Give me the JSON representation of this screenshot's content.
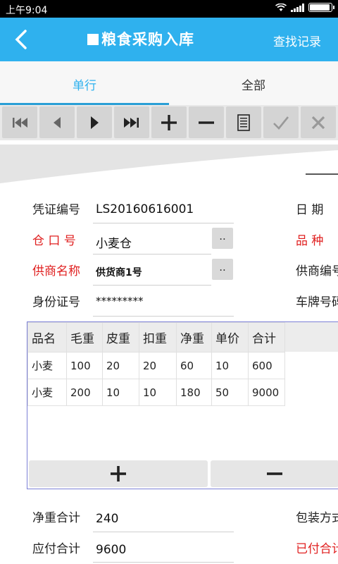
{
  "status": {
    "time": "上午9:04"
  },
  "appbar": {
    "title": "粮食采购入库",
    "find": "查找记录"
  },
  "tabs": [
    {
      "label": "单行"
    },
    {
      "label": "全部"
    }
  ],
  "toolbar": [
    "first-icon",
    "prev-icon",
    "next-icon",
    "last-icon",
    "add-icon",
    "remove-icon",
    "document-icon",
    "check-icon",
    "cancel-icon"
  ],
  "form": {
    "voucher_label": "凭证编号",
    "voucher_value": "LS20160616001",
    "date_label": "日 期",
    "warehouse_label": "仓 口 号",
    "warehouse_value": "小麦仓",
    "variety_label": "品 种",
    "supplier_label": "供商名称",
    "supplier_value": "供货商1号",
    "supplier_code_label": "供商编号",
    "id_label": "身份证号",
    "id_value": "*********",
    "plate_label": "车牌号码",
    "browse": ".."
  },
  "grid": {
    "columns": [
      "品名",
      "毛重",
      "皮重",
      "扣重",
      "净重",
      "单价",
      "合计"
    ],
    "rows": [
      [
        "小麦",
        "100",
        "20",
        "20",
        "60",
        "10",
        "600"
      ],
      [
        "小麦",
        "200",
        "10",
        "10",
        "180",
        "50",
        "9000"
      ]
    ]
  },
  "totals": {
    "net_label": "净重合计",
    "net_value": "240",
    "pack_label": "包装方式",
    "due_label": "应付合计",
    "due_value": "9600",
    "paid_label": "已付合计"
  },
  "colors": {
    "accent": "#2fb1ee",
    "required": "#e02020",
    "grid_border": "#7b7fd6"
  }
}
